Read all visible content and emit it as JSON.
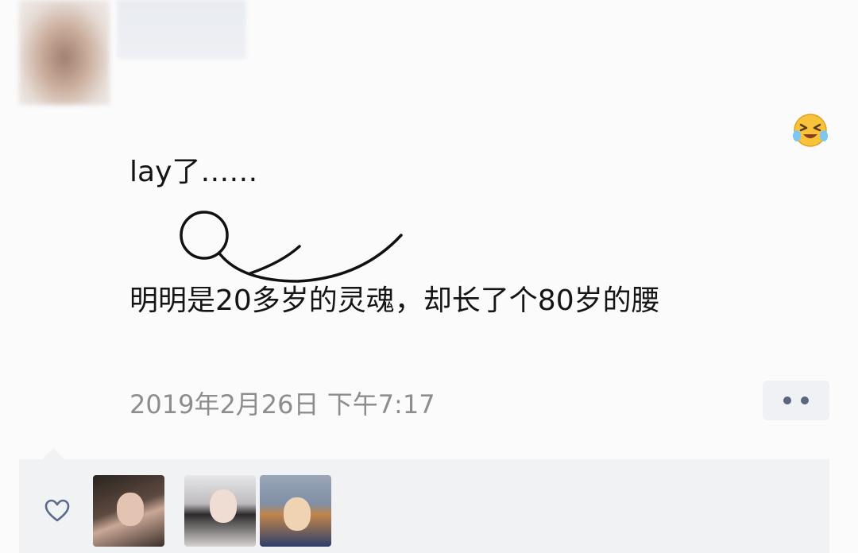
{
  "post": {
    "line1": "lay了……",
    "line2": "明明是20多岁的灵魂，却长了个80岁的腰",
    "timestamp": "2019年2月26日 下午7:17"
  },
  "icons": {
    "emoji": "laughing-crying-emoji-icon",
    "more": "more-dots-icon",
    "like": "heart-outline-icon"
  },
  "colors": {
    "text": "#151515",
    "timestamp": "#8d8d8d",
    "more_dots": "#5a6580",
    "likes_background": "#f1f2f4"
  },
  "likes": {
    "avatars": [
      "liker-avatar-1",
      "liker-avatar-2",
      "liker-avatar-3"
    ]
  }
}
